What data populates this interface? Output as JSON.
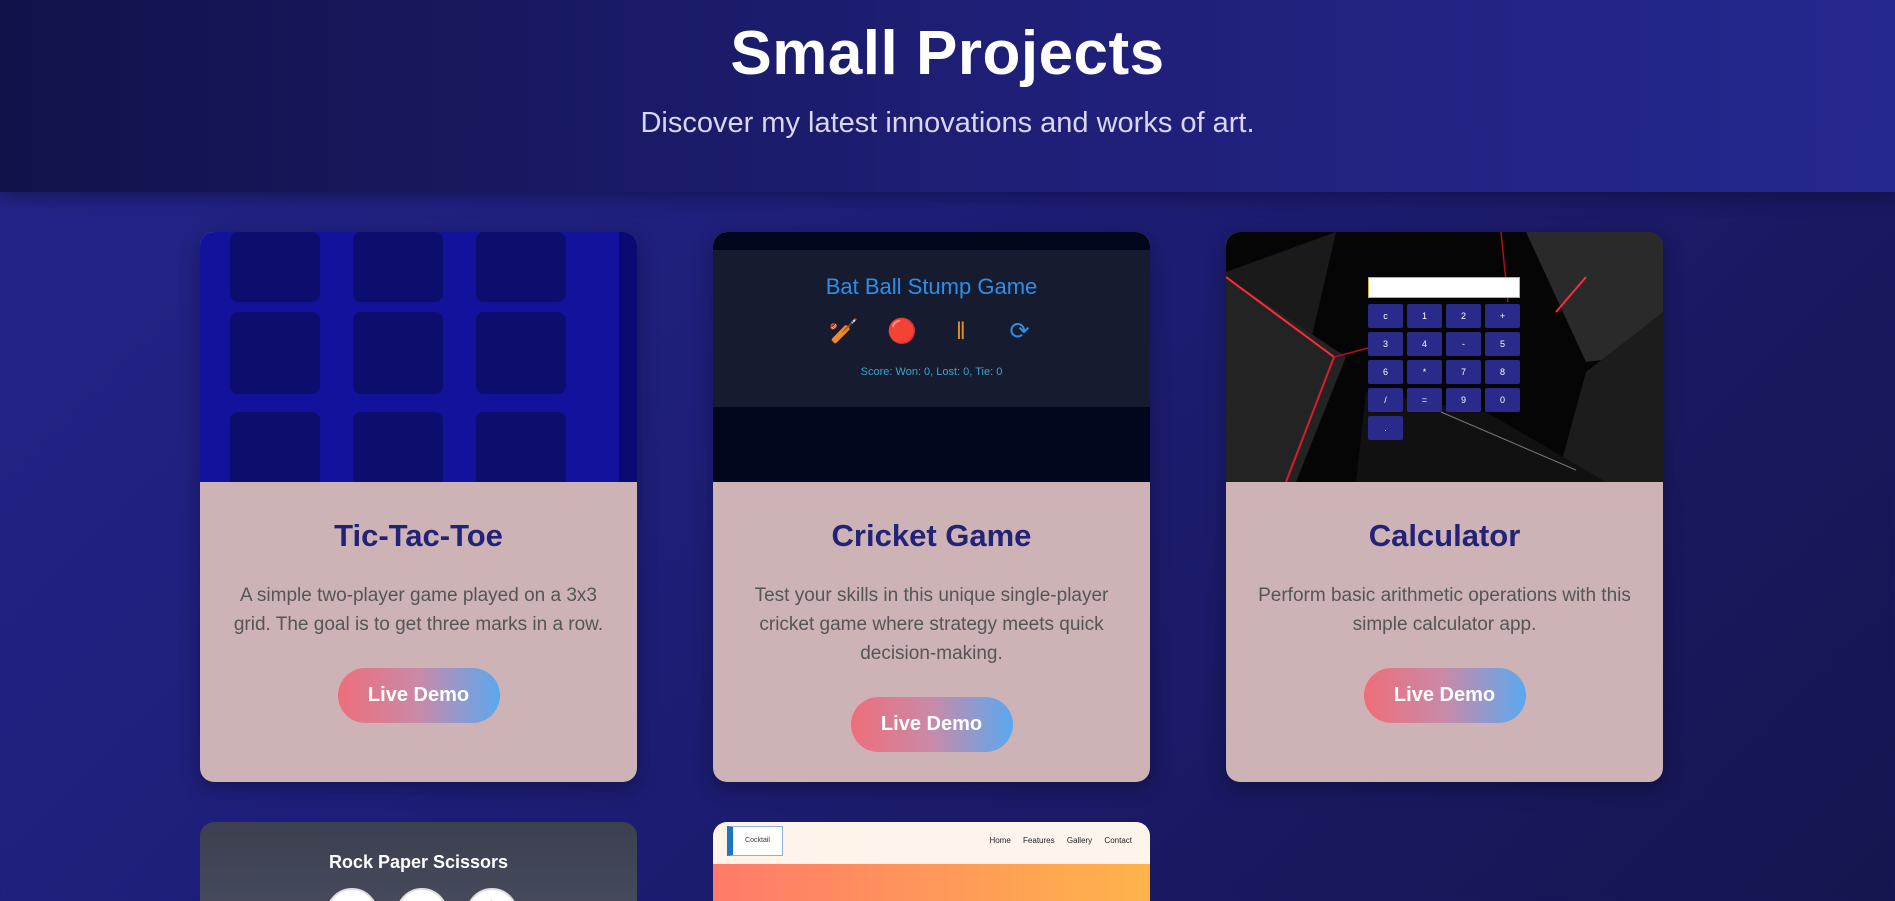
{
  "header": {
    "title": "Small Projects",
    "subtitle": "Discover my latest innovations and works of art."
  },
  "projects": [
    {
      "title": "Tic-Tac-Toe",
      "description": "A simple two-player game played on a 3x3 grid. The goal is to get three marks in a row.",
      "button": "Live Demo"
    },
    {
      "title": "Cricket Game",
      "description": "Test your skills in this unique single-player cricket game where strategy meets quick decision-making.",
      "button": "Live Demo",
      "preview": {
        "game_title": "Bat Ball Stump Game",
        "icons": [
          "bat-icon",
          "ball-icon",
          "stump-icon",
          "reset-icon"
        ],
        "score": "Score: Won: 0, Lost: 0, Tie: 0"
      }
    },
    {
      "title": "Calculator",
      "description": "Perform basic arithmetic operations with this simple calculator app.",
      "button": "Live Demo",
      "preview": {
        "keys": [
          "c",
          "1",
          "2",
          "+",
          "3",
          "4",
          "-",
          "5",
          "6",
          "*",
          "7",
          "8",
          "/",
          "=",
          "9",
          "0",
          "."
        ]
      }
    },
    {
      "preview": {
        "title": "Rock Paper Scissors",
        "icons": [
          "rock-icon",
          "paper-icon",
          "scissors-icon"
        ]
      }
    },
    {
      "preview": {
        "logo": "Cocktail",
        "nav": [
          "Home",
          "Features",
          "Gallery",
          "Contact"
        ]
      }
    }
  ],
  "colors": {
    "accent_title": "#222277",
    "card_bg": "#cdb3b6",
    "button_gradient_start": "#ee6e7a",
    "button_gradient_end": "#5aa8f0"
  }
}
